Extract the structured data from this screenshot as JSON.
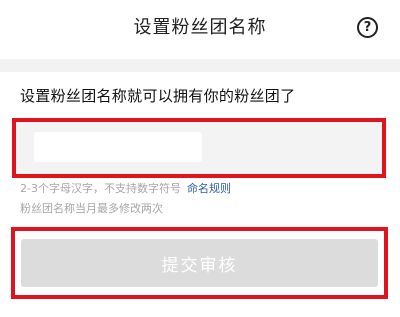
{
  "header": {
    "title": "设置粉丝团名称",
    "help_icon": "question-circle-icon",
    "help_glyph": "?"
  },
  "main": {
    "instruction": "设置粉丝团名称就可以拥有你的粉丝团了",
    "input": {
      "value": "",
      "placeholder": ""
    },
    "hint": "2-3个字母汉字，不支持数字符号",
    "rules_link": "命名规则",
    "hint2": "粉丝团名称当月最多修改两次",
    "submit_label": "提交审核"
  },
  "colors": {
    "highlight_border": "#e0131e",
    "link": "#2f5fa8",
    "disabled_button": "#dcdcdc"
  }
}
